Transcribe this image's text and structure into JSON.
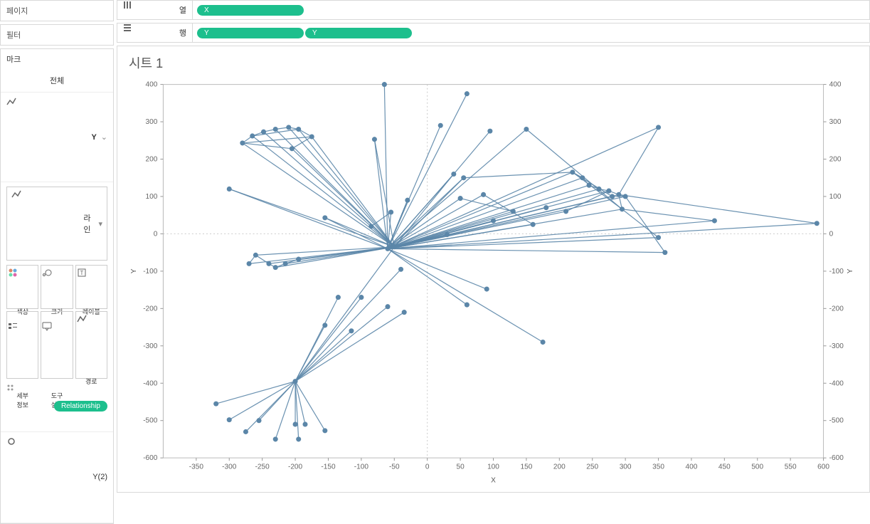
{
  "sidebar": {
    "pages_title": "페이지",
    "filters_title": "필터",
    "marks_title": "마크",
    "all_label": "전체",
    "y_label": "Y",
    "mark_type_label": "라인",
    "btn_color": "색상",
    "btn_size": "크기",
    "btn_label": "레이블",
    "btn_detail": "세부\n정보",
    "btn_tooltip": "도구\n설명",
    "btn_path": "경로",
    "pill_relationship": "Relationship",
    "y2_label": "Y(2)"
  },
  "shelves": {
    "columns_label": "열",
    "rows_label": "행",
    "col_pill": "X",
    "row_pill_1": "Y",
    "row_pill_2": "Y"
  },
  "sheet_title": "시트 1",
  "chart_data": {
    "type": "scatter",
    "title": "시트 1",
    "xlabel": "X",
    "ylabel": "Y",
    "ylabel_right": "Y",
    "xlim": [
      -400,
      600
    ],
    "ylim": [
      -600,
      400
    ],
    "x_ticks": [
      -350,
      -300,
      -250,
      -200,
      -150,
      -100,
      -50,
      0,
      50,
      100,
      150,
      200,
      250,
      300,
      350,
      400,
      450,
      500,
      550,
      600
    ],
    "y_ticks": [
      -600,
      -500,
      -400,
      -300,
      -200,
      -100,
      0,
      100,
      200,
      300,
      400
    ],
    "points": [
      [
        -320,
        -455
      ],
      [
        -300,
        -498
      ],
      [
        -275,
        -530
      ],
      [
        -255,
        -500
      ],
      [
        -230,
        -550
      ],
      [
        -200,
        -510
      ],
      [
        -195,
        -550
      ],
      [
        -185,
        -510
      ],
      [
        -155,
        -527
      ],
      [
        -200,
        -395
      ],
      [
        -155,
        -245
      ],
      [
        -135,
        -170
      ],
      [
        -115,
        -260
      ],
      [
        -100,
        -170
      ],
      [
        -60,
        -195
      ],
      [
        -35,
        -210
      ],
      [
        -40,
        -95
      ],
      [
        -50,
        -35
      ],
      [
        -155,
        43
      ],
      [
        -300,
        120
      ],
      [
        -280,
        243
      ],
      [
        -265,
        262
      ],
      [
        -248,
        273
      ],
      [
        -230,
        280
      ],
      [
        -210,
        285
      ],
      [
        -195,
        280
      ],
      [
        -175,
        260
      ],
      [
        -205,
        228
      ],
      [
        -80,
        253
      ],
      [
        -60,
        -40
      ],
      [
        -55,
        58
      ],
      [
        -85,
        20
      ],
      [
        20,
        290
      ],
      [
        40,
        160
      ],
      [
        55,
        150
      ],
      [
        30,
        -2
      ],
      [
        -30,
        90
      ],
      [
        60,
        375
      ],
      [
        -65,
        400
      ],
      [
        60,
        -190
      ],
      [
        90,
        -148
      ],
      [
        150,
        280
      ],
      [
        175,
        -290
      ],
      [
        220,
        165
      ],
      [
        235,
        150
      ],
      [
        245,
        130
      ],
      [
        260,
        120
      ],
      [
        275,
        115
      ],
      [
        290,
        105
      ],
      [
        300,
        100
      ],
      [
        280,
        100
      ],
      [
        295,
        66
      ],
      [
        50,
        95
      ],
      [
        85,
        105
      ],
      [
        100,
        35
      ],
      [
        130,
        60
      ],
      [
        160,
        25
      ],
      [
        180,
        70
      ],
      [
        210,
        60
      ],
      [
        350,
        -10
      ],
      [
        360,
        -50
      ],
      [
        350,
        285
      ],
      [
        435,
        35
      ],
      [
        590,
        28
      ],
      [
        -270,
        -80
      ],
      [
        -260,
        -57
      ],
      [
        -240,
        -80
      ],
      [
        -230,
        -90
      ],
      [
        -215,
        -80
      ],
      [
        -195,
        -68
      ],
      [
        95,
        275
      ]
    ],
    "edges": [
      [
        0,
        9
      ],
      [
        1,
        9
      ],
      [
        2,
        9
      ],
      [
        3,
        9
      ],
      [
        4,
        9
      ],
      [
        5,
        9
      ],
      [
        6,
        9
      ],
      [
        7,
        9
      ],
      [
        8,
        9
      ],
      [
        9,
        10
      ],
      [
        9,
        11
      ],
      [
        9,
        12
      ],
      [
        9,
        13
      ],
      [
        9,
        14
      ],
      [
        9,
        15
      ],
      [
        9,
        16
      ],
      [
        9,
        17
      ],
      [
        17,
        18
      ],
      [
        17,
        19
      ],
      [
        17,
        20
      ],
      [
        17,
        21
      ],
      [
        17,
        22
      ],
      [
        17,
        23
      ],
      [
        17,
        24
      ],
      [
        17,
        25
      ],
      [
        17,
        26
      ],
      [
        17,
        27
      ],
      [
        20,
        21
      ],
      [
        21,
        22
      ],
      [
        22,
        23
      ],
      [
        23,
        24
      ],
      [
        24,
        25
      ],
      [
        25,
        26
      ],
      [
        26,
        27
      ],
      [
        20,
        27
      ],
      [
        20,
        26
      ],
      [
        21,
        25
      ],
      [
        17,
        28
      ],
      [
        28,
        29
      ],
      [
        29,
        30
      ],
      [
        30,
        31
      ],
      [
        29,
        32
      ],
      [
        29,
        33
      ],
      [
        29,
        34
      ],
      [
        29,
        35
      ],
      [
        29,
        36
      ],
      [
        29,
        37
      ],
      [
        29,
        38
      ],
      [
        29,
        39
      ],
      [
        29,
        40
      ],
      [
        29,
        41
      ],
      [
        29,
        42
      ],
      [
        29,
        19
      ],
      [
        29,
        18
      ],
      [
        29,
        17
      ],
      [
        29,
        43
      ],
      [
        29,
        44
      ],
      [
        29,
        45
      ],
      [
        29,
        46
      ],
      [
        29,
        47
      ],
      [
        29,
        48
      ],
      [
        29,
        49
      ],
      [
        29,
        50
      ],
      [
        29,
        51
      ],
      [
        43,
        44
      ],
      [
        44,
        45
      ],
      [
        45,
        46
      ],
      [
        46,
        47
      ],
      [
        47,
        48
      ],
      [
        48,
        49
      ],
      [
        49,
        50
      ],
      [
        50,
        43
      ],
      [
        43,
        51
      ],
      [
        51,
        48
      ],
      [
        29,
        52
      ],
      [
        29,
        53
      ],
      [
        29,
        54
      ],
      [
        29,
        55
      ],
      [
        29,
        56
      ],
      [
        29,
        57
      ],
      [
        29,
        58
      ],
      [
        29,
        59
      ],
      [
        29,
        60
      ],
      [
        29,
        61
      ],
      [
        29,
        62
      ],
      [
        29,
        63
      ],
      [
        52,
        55
      ],
      [
        53,
        56
      ],
      [
        47,
        58
      ],
      [
        49,
        60
      ],
      [
        48,
        61
      ],
      [
        51,
        62
      ],
      [
        48,
        63
      ],
      [
        51,
        59
      ],
      [
        17,
        64
      ],
      [
        17,
        65
      ],
      [
        17,
        66
      ],
      [
        17,
        67
      ],
      [
        17,
        68
      ],
      [
        17,
        69
      ],
      [
        64,
        65
      ],
      [
        65,
        66
      ],
      [
        66,
        67
      ],
      [
        67,
        68
      ],
      [
        68,
        69
      ],
      [
        33,
        29
      ],
      [
        33,
        17
      ],
      [
        34,
        43
      ],
      [
        34,
        17
      ],
      [
        35,
        17
      ],
      [
        36,
        29
      ],
      [
        33,
        70
      ],
      [
        41,
        51
      ]
    ]
  }
}
